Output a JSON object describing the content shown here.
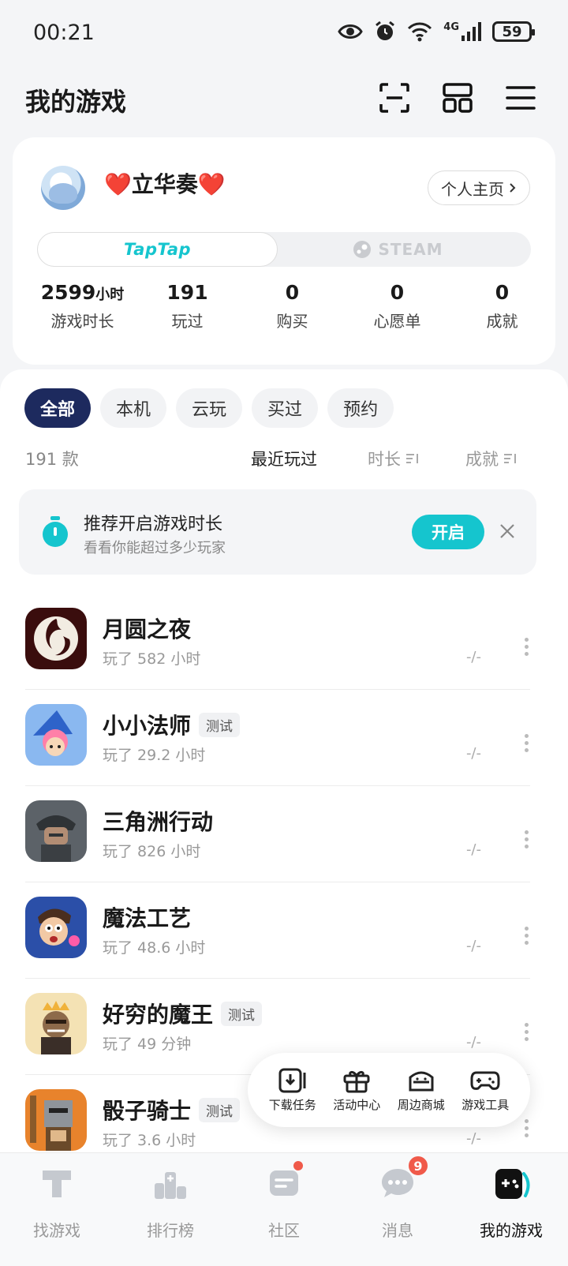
{
  "status_bar": {
    "time": "00:21",
    "battery": "59",
    "network": "4G"
  },
  "header": {
    "title": "我的游戏"
  },
  "profile": {
    "heart_left": "❤️",
    "name": "立华奏",
    "heart_right": "❤️",
    "profile_link": "个人主页",
    "platforms": [
      "TapTap",
      "STEAM"
    ],
    "stats": [
      {
        "value": "2599",
        "unit": "小时",
        "label": "游戏时长"
      },
      {
        "value": "191",
        "unit": "",
        "label": "玩过"
      },
      {
        "value": "0",
        "unit": "",
        "label": "购买"
      },
      {
        "value": "0",
        "unit": "",
        "label": "心愿单"
      },
      {
        "value": "0",
        "unit": "",
        "label": "成就"
      }
    ]
  },
  "filters": [
    "全部",
    "本机",
    "云玩",
    "买过",
    "预约"
  ],
  "count_label": "191 款",
  "sort_options": [
    "最近玩过",
    "时长",
    "成就"
  ],
  "banner": {
    "title": "推荐开启游戏时长",
    "subtitle": "看看你能超过多少玩家",
    "button": "开启"
  },
  "games": [
    {
      "name": "月圆之夜",
      "badge": "",
      "time": "玩了 582 小时",
      "achievement": "-/-"
    },
    {
      "name": "小小法师",
      "badge": "测试",
      "time": "玩了 29.2 小时",
      "achievement": "-/-"
    },
    {
      "name": "三角洲行动",
      "badge": "",
      "time": "玩了 826 小时",
      "achievement": "-/-"
    },
    {
      "name": "魔法工艺",
      "badge": "",
      "time": "玩了 48.6 小时",
      "achievement": "-/-"
    },
    {
      "name": "好穷的魔王",
      "badge": "测试",
      "time": "玩了 49 分钟",
      "achievement": "-/-"
    },
    {
      "name": "骰子骑士",
      "badge": "测试",
      "time": "玩了 3.6 小时",
      "achievement": "-/-"
    }
  ],
  "float_menu": [
    "下载任务",
    "活动中心",
    "周边商城",
    "游戏工具"
  ],
  "bottom_nav": [
    {
      "label": "找游戏"
    },
    {
      "label": "排行榜"
    },
    {
      "label": "社区"
    },
    {
      "label": "消息",
      "badge": "9"
    },
    {
      "label": "我的游戏"
    }
  ],
  "colors": {
    "accent": "#15c5ce",
    "chip_active": "#1d2a5e",
    "badge_red": "#f05a4a"
  }
}
